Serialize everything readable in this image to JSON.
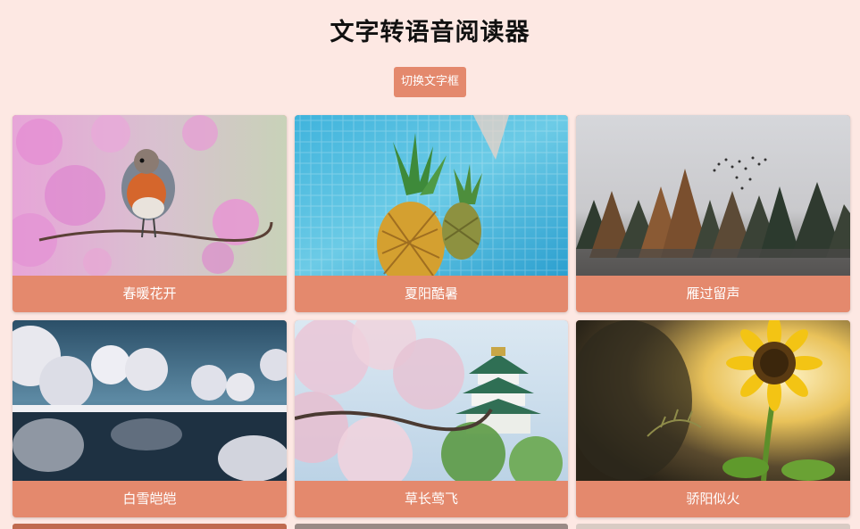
{
  "page": {
    "title": "文字转语音阅读器",
    "toggle_button": "切换文字框"
  },
  "colors": {
    "background": "#fde8e3",
    "accent": "#e4896d"
  },
  "cards": [
    {
      "caption": "春暖花开",
      "image": "robin-on-pink-blossom"
    },
    {
      "caption": "夏阳酷暑",
      "image": "pineapples-in-pool"
    },
    {
      "caption": "雁过留声",
      "image": "pine-forest-with-birds"
    },
    {
      "caption": "白雪皑皑",
      "image": "snowy-trees-by-lake"
    },
    {
      "caption": "草长莺飞",
      "image": "cherry-blossoms-castle"
    },
    {
      "caption": "骄阳似火",
      "image": "sunflower-at-sunset"
    }
  ]
}
